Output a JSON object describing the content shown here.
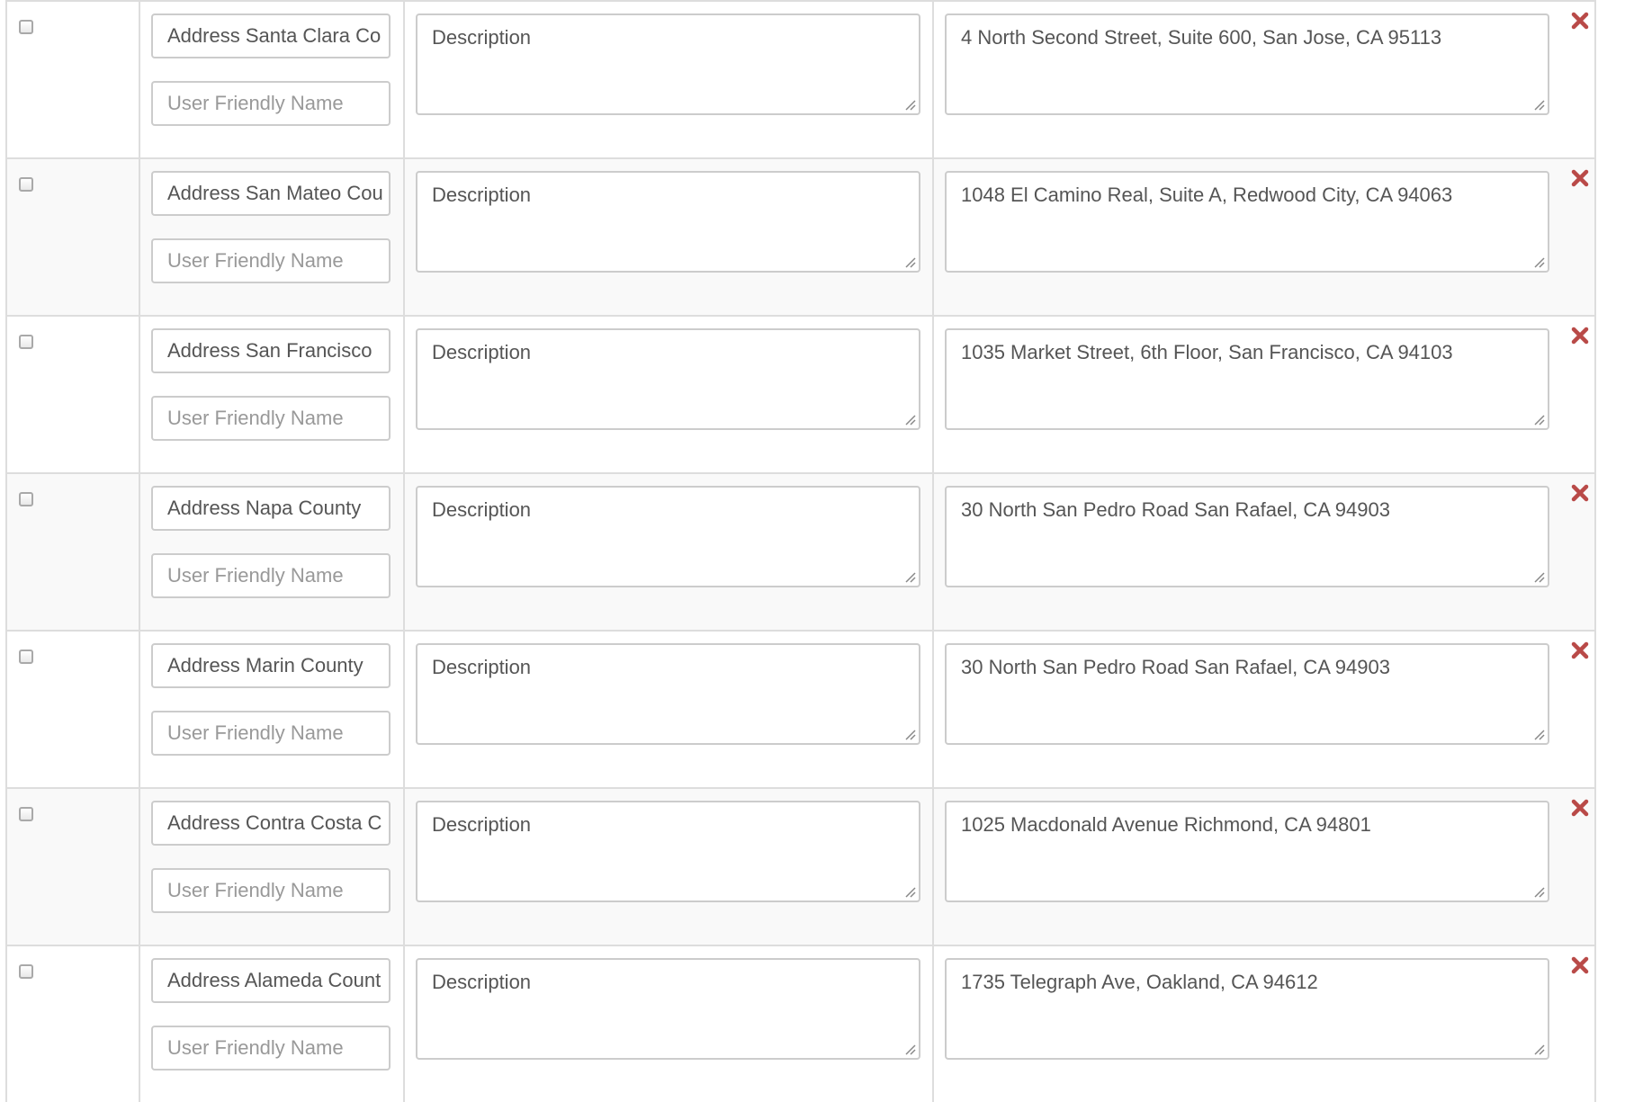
{
  "placeholders": {
    "friendly_name": "User Friendly Name",
    "description": "Description"
  },
  "colors": {
    "remove_icon": "#b94a48",
    "border": "#dddddd",
    "stripe": "#f9f9f9"
  },
  "rows": [
    {
      "name_value": "Address Santa Clara Co",
      "address_value": "4 North Second Street, Suite 600, San Jose, CA 95113"
    },
    {
      "name_value": "Address San Mateo Cou",
      "address_value": "1048 El Camino Real, Suite A, Redwood City, CA 94063"
    },
    {
      "name_value": "Address San Francisco",
      "address_value": "1035 Market Street, 6th Floor, San Francisco, CA 94103"
    },
    {
      "name_value": "Address Napa County",
      "address_value": "30 North San Pedro Road San Rafael, CA 94903"
    },
    {
      "name_value": "Address Marin County",
      "address_value": "30 North San Pedro Road San Rafael, CA 94903"
    },
    {
      "name_value": "Address Contra Costa C",
      "address_value": "1025 Macdonald Avenue Richmond, CA 94801"
    },
    {
      "name_value": "Address Alameda Count",
      "address_value": "1735 Telegraph Ave, Oakland, CA 94612"
    }
  ]
}
